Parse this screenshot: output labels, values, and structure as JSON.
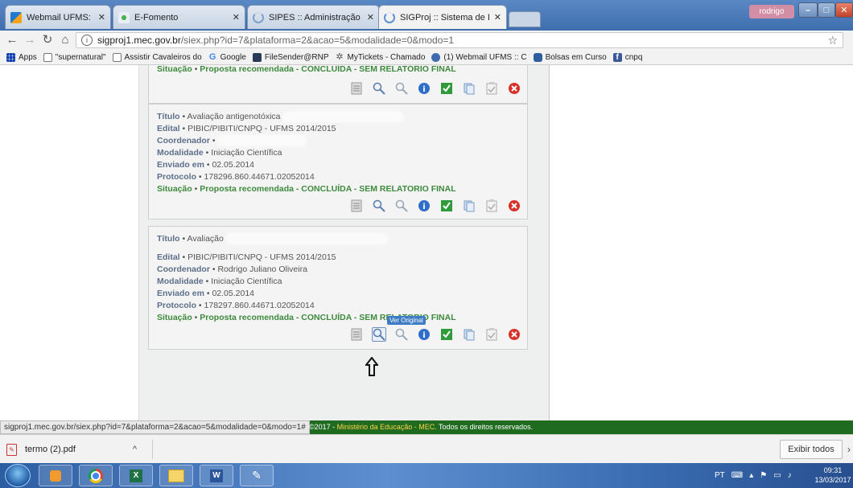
{
  "browser": {
    "tabs": [
      {
        "label": "Webmail UFMS: Entrada",
        "icon": "webmail-icon"
      },
      {
        "label": "E-Fomento",
        "icon": "e-fomento-icon"
      },
      {
        "label": "SIPES :: Administração",
        "icon": "loading-icon"
      },
      {
        "label": "SIGProj :: Sistema de Info",
        "icon": "loading-icon"
      }
    ],
    "profile_name": "rodrigo",
    "url_domain": "sigproj1.mec.gov.br",
    "url_path": "/siex.php?id=7&plataforma=2&acao=5&modalidade=0&modo=1",
    "bookmarks": [
      {
        "label": "Apps",
        "icon": "apps-grid-icon"
      },
      {
        "label": "\"supernatural\"",
        "icon": "page-icon"
      },
      {
        "label": "Assistir Cavaleiros do",
        "icon": "page-icon"
      },
      {
        "label": "Google",
        "icon": "google-icon"
      },
      {
        "label": "FileSender@RNP",
        "icon": "filesender-icon"
      },
      {
        "label": "MyTickets - Chamado",
        "icon": "mytickets-icon"
      },
      {
        "label": "(1) Webmail UFMS :: C",
        "icon": "webmail-icon"
      },
      {
        "label": "Bolsas em Curso",
        "icon": "bolsas-icon"
      },
      {
        "label": "cnpq",
        "icon": "facebook-icon"
      }
    ]
  },
  "page": {
    "top_partial_status_label": "Situação",
    "top_partial_status_value": "Proposta recomendada - CONCLUÍDA - SEM RELATÓRIO FINAL",
    "cards": [
      {
        "titulo_label": "Título",
        "titulo_value": "Avaliação antigenotóxica",
        "edital_label": "Edital",
        "edital_value": "PIBIC/PIBITI/CNPQ - UFMS 2014/2015",
        "coordenador_label": "Coordenador",
        "coordenador_value": "",
        "modalidade_label": "Modalidade",
        "modalidade_value": "Iniciação Científica",
        "enviado_label": "Enviado em",
        "enviado_value": "02.05.2014",
        "protocolo_label": "Protocolo",
        "protocolo_value": "178296.860.44671.02052014",
        "situacao_label": "Situação",
        "situacao_value": "Proposta recomendada - CONCLUÍDA - SEM RELATORIO FINAL"
      },
      {
        "titulo_label": "Título",
        "titulo_value": "Avaliação",
        "edital_label": "Edital",
        "edital_value": "PIBIC/PIBITI/CNPQ - UFMS 2014/2015",
        "coordenador_label": "Coordenador",
        "coordenador_value": "Rodrigo Juliano Oliveira",
        "modalidade_label": "Modalidade",
        "modalidade_value": "Iniciação Científica",
        "enviado_label": "Enviado em",
        "enviado_value": "02.05.2014",
        "protocolo_label": "Protocolo",
        "protocolo_value": "178297.860.44671.02052014",
        "situacao_label": "Situação",
        "situacao_value": "Proposta recomendada - CONCLUÍDA - SEM RELATORIO FINAL"
      }
    ],
    "tooltip": "Ver Original",
    "action_icons": [
      "document-icon",
      "view-original-icon",
      "search-icon",
      "info-icon",
      "check-icon",
      "copy-icon",
      "checklist-icon",
      "delete-icon"
    ]
  },
  "footer": {
    "status_url": "sigproj1.mec.gov.br/siex.php?id=7&plataforma=2&acao=5&modalidade=0&modo=1#",
    "copyright_prefix": "©2017 - ",
    "copyright_link": "Ministério da Educação - MEC.",
    "copyright_suffix": " Todos os direitos reservados."
  },
  "downloads": {
    "file_name": "termo (2).pdf",
    "show_all_label": "Exibir todos"
  },
  "taskbar": {
    "language": "PT",
    "time": "09:31",
    "date": "13/03/2017"
  },
  "colors": {
    "label_blue": "#5d6f8a",
    "status_green": "#3d8a3d",
    "footer_green": "#1f6b20",
    "taskbar_blue": "#3b6db3"
  }
}
